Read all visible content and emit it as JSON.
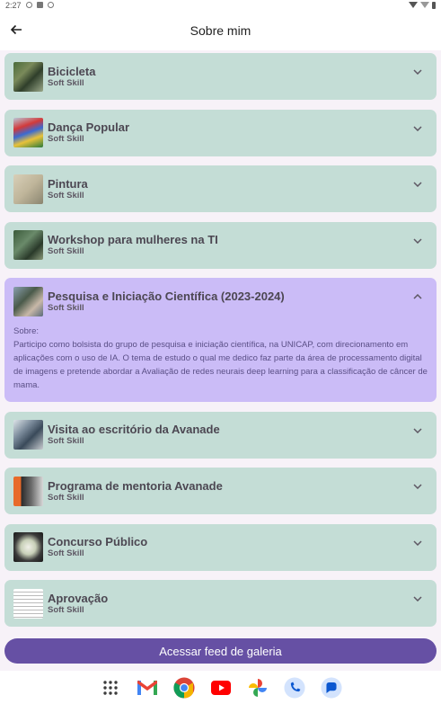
{
  "status": {
    "time": "2:27"
  },
  "appbar": {
    "title": "Sobre mim"
  },
  "cards": [
    {
      "title": "Bicicleta",
      "subtitle": "Soft Skill"
    },
    {
      "title": "Dança Popular",
      "subtitle": "Soft Skill"
    },
    {
      "title": "Pintura",
      "subtitle": "Soft Skill"
    },
    {
      "title": "Workshop para mulheres na TI",
      "subtitle": "Soft Skill"
    },
    {
      "title": "Pesquisa e Iniciação Científica (2023-2024)",
      "subtitle": "Soft Skill",
      "detail_label": "Sobre:",
      "detail_text": "Participo como bolsista do grupo de pesquisa e iniciação científica, na UNICAP, com direcionamento em aplicações com o uso de IA. O tema de estudo o qual me dedico faz parte da área de processamento digital de imagens e pretende abordar a Avaliação de redes neurais deep learning para a classificação de câncer de mama."
    },
    {
      "title": "Visita ao escritório da Avanade",
      "subtitle": "Soft Skill"
    },
    {
      "title": "Programa de mentoria Avanade",
      "subtitle": "Soft Skill"
    },
    {
      "title": "Concurso Público",
      "subtitle": "Soft Skill"
    },
    {
      "title": "Aprovação",
      "subtitle": "Soft Skill"
    }
  ],
  "cta": {
    "label": "Acessar feed de galeria"
  },
  "dock": [
    "apps-grid-icon",
    "gmail-icon",
    "chrome-icon",
    "youtube-icon",
    "photos-icon",
    "phone-icon",
    "messages-icon"
  ],
  "colors": {
    "card": "#c4ddd6",
    "card_expanded": "#cbbcf7",
    "primary": "#6650a4"
  }
}
